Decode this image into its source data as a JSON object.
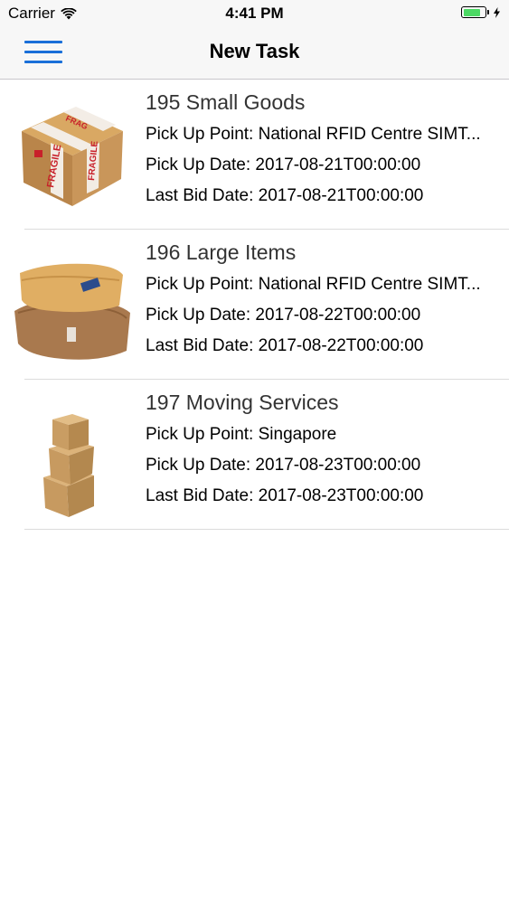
{
  "status_bar": {
    "carrier": "Carrier",
    "time": "4:41 PM",
    "battery_level": 0.8,
    "battery_color": "#4cd964"
  },
  "nav": {
    "title": "New Task",
    "menu_icon": "hamburger-menu-icon",
    "accent_color": "#1a6fd8"
  },
  "tasks": [
    {
      "title": "195 Small Goods",
      "pickup_point": "Pick Up Point: National RFID Centre SIMT...",
      "pickup_date": "Pick Up Date: 2017-08-21T00:00:00",
      "last_bid_date": "Last Bid Date: 2017-08-21T00:00:00",
      "thumbnail": "fragile-parcel-image"
    },
    {
      "title": "196 Large Items",
      "pickup_point": "Pick Up Point: National RFID Centre SIMT...",
      "pickup_date": "Pick Up Date: 2017-08-22T00:00:00",
      "last_bid_date": "Last Bid Date: 2017-08-22T00:00:00",
      "thumbnail": "padded-envelopes-image"
    },
    {
      "title": "197 Moving Services",
      "pickup_point": "Pick Up Point: Singapore",
      "pickup_date": "Pick Up Date: 2017-08-23T00:00:00",
      "last_bid_date": "Last Bid Date: 2017-08-23T00:00:00",
      "thumbnail": "stacked-boxes-image"
    }
  ]
}
